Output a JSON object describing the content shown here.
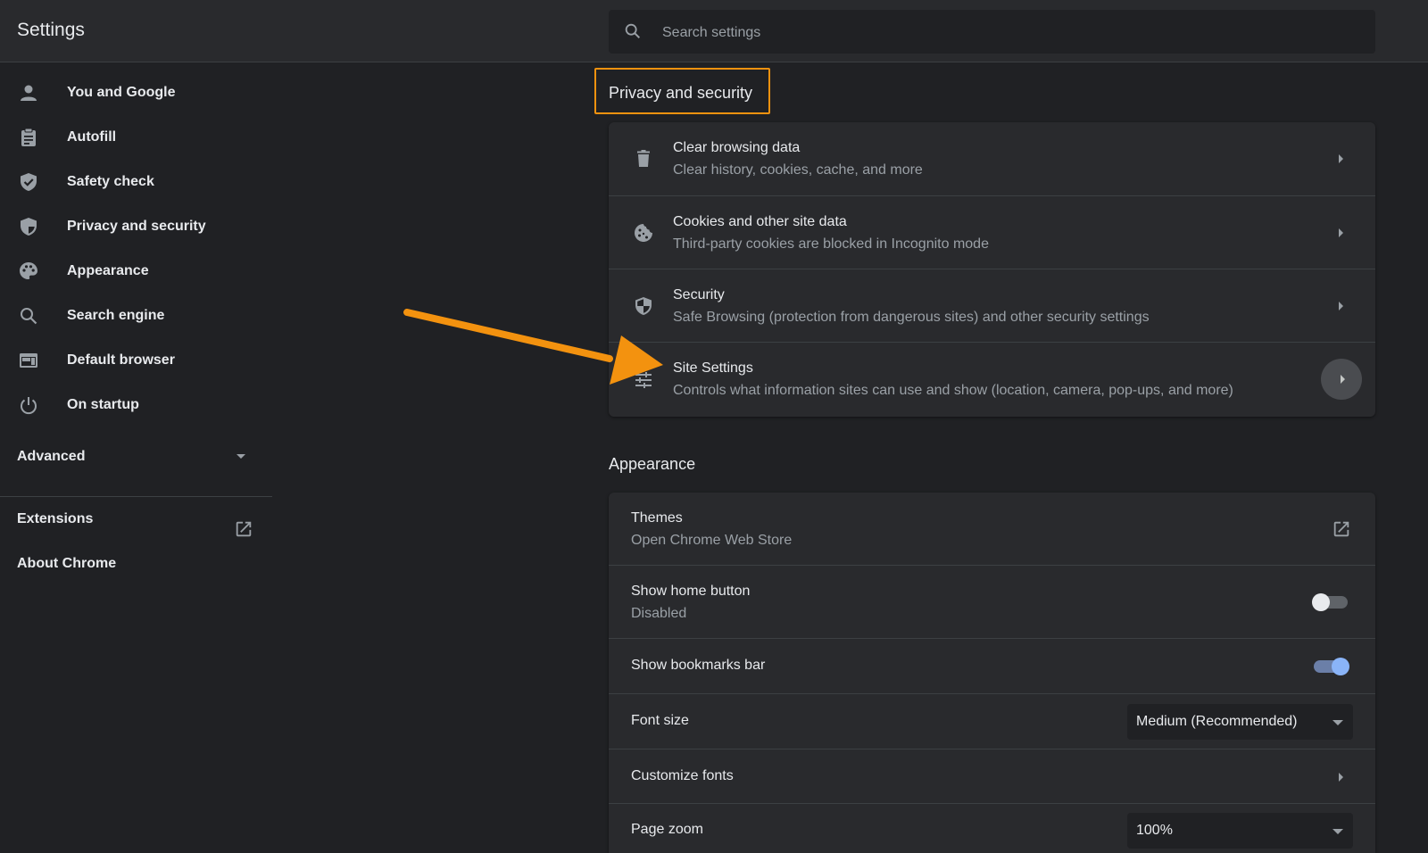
{
  "header": {
    "title": "Settings",
    "search_placeholder": "Search settings"
  },
  "sidebar": {
    "items": [
      {
        "label": "You and Google",
        "icon": "person-icon"
      },
      {
        "label": "Autofill",
        "icon": "clipboard-icon"
      },
      {
        "label": "Safety check",
        "icon": "shield-check-icon"
      },
      {
        "label": "Privacy and security",
        "icon": "shield-half-icon"
      },
      {
        "label": "Appearance",
        "icon": "palette-icon"
      },
      {
        "label": "Search engine",
        "icon": "search-icon"
      },
      {
        "label": "Default browser",
        "icon": "browser-icon"
      },
      {
        "label": "On startup",
        "icon": "power-icon"
      }
    ],
    "advanced_label": "Advanced",
    "extensions_label": "Extensions",
    "about_label": "About Chrome"
  },
  "privacy": {
    "title": "Privacy and security",
    "rows": [
      {
        "title": "Clear browsing data",
        "subtitle": "Clear history, cookies, cache, and more",
        "icon": "trash-icon"
      },
      {
        "title": "Cookies and other site data",
        "subtitle": "Third-party cookies are blocked in Incognito mode",
        "icon": "cookie-icon"
      },
      {
        "title": "Security",
        "subtitle": "Safe Browsing (protection from dangerous sites) and other security settings",
        "icon": "shield-half-icon"
      },
      {
        "title": "Site Settings",
        "subtitle": "Controls what information sites can use and show (location, camera, pop-ups, and more)",
        "icon": "tune-icon"
      }
    ]
  },
  "appearance": {
    "title": "Appearance",
    "themes": {
      "title": "Themes",
      "subtitle": "Open Chrome Web Store"
    },
    "home_button": {
      "title": "Show home button",
      "subtitle": "Disabled",
      "enabled": false
    },
    "bookmarks_bar": {
      "title": "Show bookmarks bar",
      "enabled": true
    },
    "font_size": {
      "title": "Font size",
      "value": "Medium (Recommended)"
    },
    "customize_fonts": {
      "title": "Customize fonts"
    },
    "page_zoom": {
      "title": "Page zoom",
      "value": "100%"
    }
  },
  "colors": {
    "highlight": "#f3920f",
    "accent": "#8ab4f8",
    "background": "#202124",
    "card": "#292a2d"
  }
}
